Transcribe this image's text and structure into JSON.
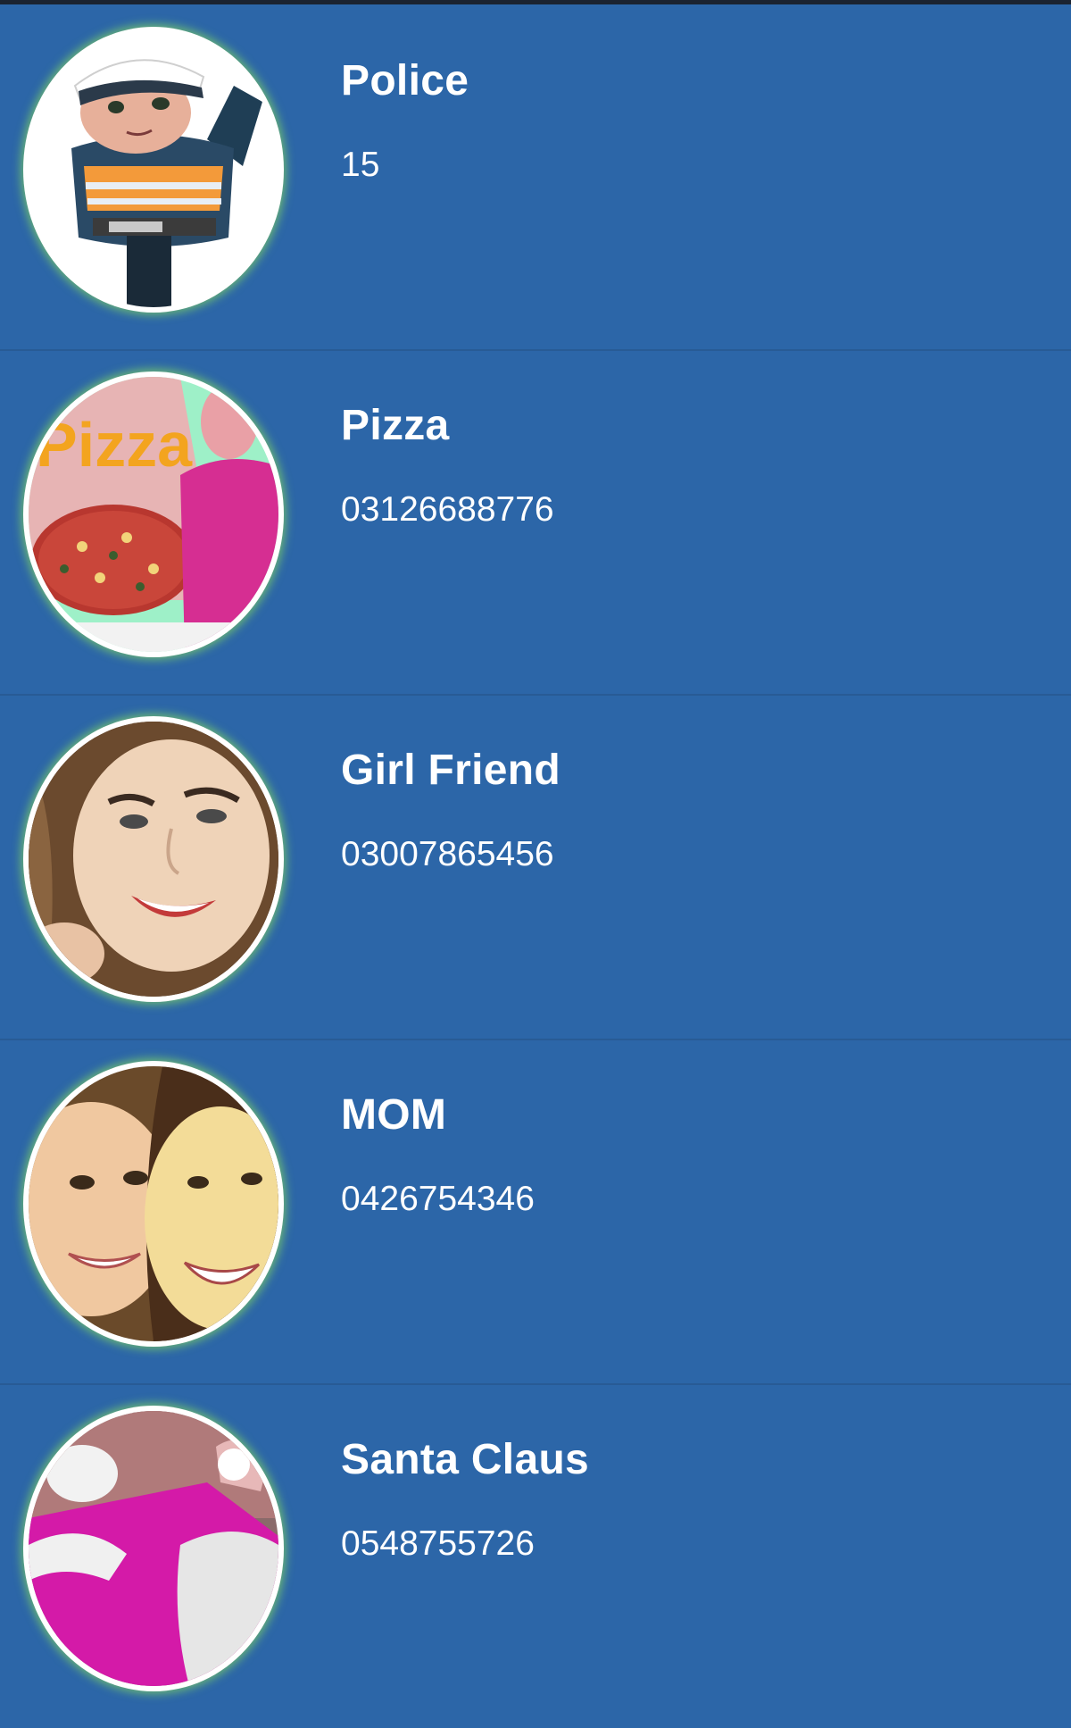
{
  "colors": {
    "background": "#2c66a8",
    "row_divider": "#285b95",
    "text": "#ffffff",
    "avatar_ring": "#ffffff",
    "avatar_glow": "#7ed066"
  },
  "contacts": [
    {
      "name": "Police",
      "number": "15",
      "avatar": "police-officer-avatar"
    },
    {
      "name": "Pizza",
      "number": "03126688776",
      "avatar": "pizza-delivery-avatar"
    },
    {
      "name": "Girl Friend",
      "number": "03007865456",
      "avatar": "girl-friend-avatar"
    },
    {
      "name": "MOM",
      "number": "0426754346",
      "avatar": "mom-avatar"
    },
    {
      "name": "Santa Claus",
      "number": "0548755726",
      "avatar": "santa-claus-avatar"
    }
  ],
  "avatar_text": {
    "pizza_box_lettering": "Pizza"
  }
}
